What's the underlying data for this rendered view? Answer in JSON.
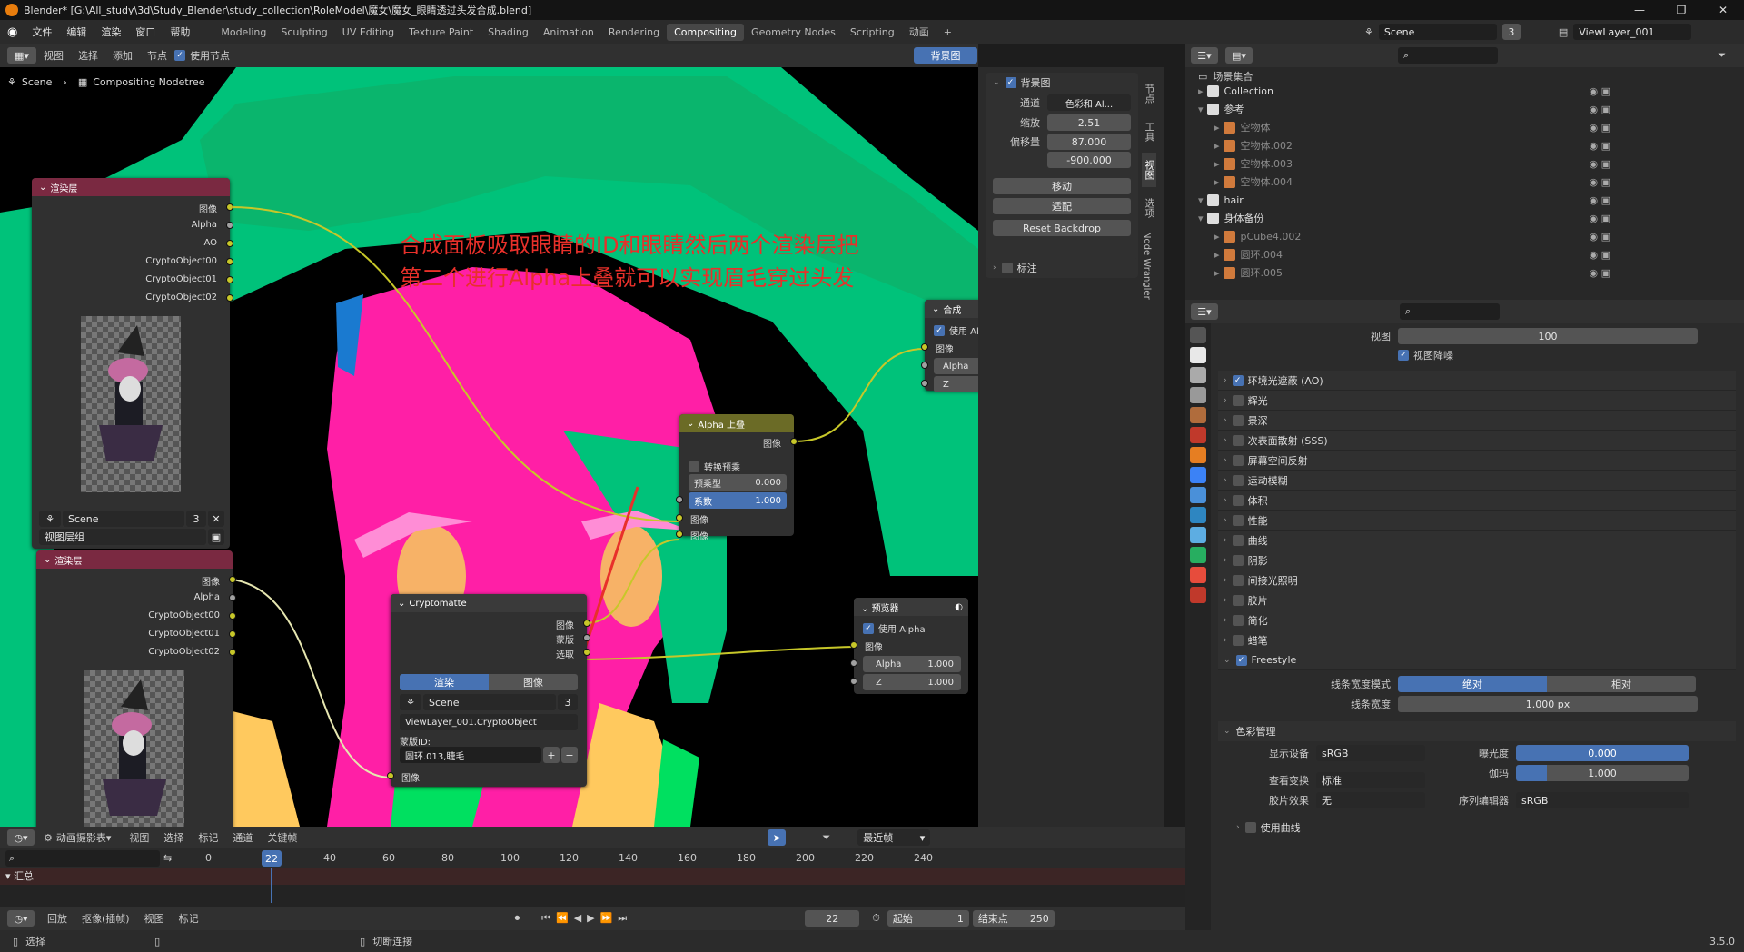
{
  "title": "Blender* [G:\\All_study\\3d\\Study_Blender\\study_collection\\RoleModel\\魔女\\魔女_眼睛透过头发合成.blend]",
  "menu": [
    "文件",
    "编辑",
    "渲染",
    "窗口",
    "帮助"
  ],
  "workspaces": [
    "Modeling",
    "Sculpting",
    "UV Editing",
    "Texture Paint",
    "Shading",
    "Animation",
    "Rendering",
    "Compositing",
    "Geometry Nodes",
    "Scripting",
    "动画"
  ],
  "active_workspace": "Compositing",
  "scene": {
    "name": "Scene",
    "count": "3"
  },
  "view_layer": "ViewLayer_001",
  "node_header": {
    "items": [
      "视图",
      "选择",
      "添加",
      "节点"
    ],
    "use_nodes": "使用节点",
    "backdrop": "背景图"
  },
  "breadcrumb": {
    "scene": "Scene",
    "tree": "Compositing Nodetree"
  },
  "annotation": {
    "line1": "合成面板吸取眼睛的ID和眼睛然后两个渲染层把",
    "line2": "第二个进行Alpha上叠就可以实现眉毛穿过头发"
  },
  "render_layer_1": {
    "title": "渲染层",
    "outputs": [
      "图像",
      "Alpha",
      "AO",
      "CryptoObject00",
      "CryptoObject01",
      "CryptoObject02"
    ],
    "scene": "Scene",
    "count": "3",
    "layer": "视图层组"
  },
  "render_layer_2": {
    "title": "渲染层",
    "outputs": [
      "图像",
      "Alpha",
      "CryptoObject00",
      "CryptoObject01",
      "CryptoObject02"
    ]
  },
  "alpha_over": {
    "title": "Alpha 上叠",
    "output": "图像",
    "convert": "转换预乘",
    "premul_label": "预乘型",
    "premul_value": "0.000",
    "fac_label": "系数",
    "fac_value": "1.000",
    "in1": "图像",
    "in2": "图像"
  },
  "composite": {
    "title": "合成",
    "use_alpha": "使用 Alpha",
    "inputs": [
      "图像",
      "Alpha",
      "Z"
    ]
  },
  "viewer": {
    "title": "预览器",
    "use_alpha": "使用 Alpha",
    "input": "图像",
    "alpha_label": "Alpha",
    "alpha_value": "1.000",
    "z_label": "Z",
    "z_value": "1.000"
  },
  "cryptomatte": {
    "title": "Cryptomatte",
    "outputs": [
      "图像",
      "蒙版",
      "选取"
    ],
    "tab1": "渲染",
    "tab2": "图像",
    "scene": "Scene",
    "count": "3",
    "layer": "ViewLayer_001.CryptoObject",
    "matte_label": "蒙版ID:",
    "matte_value": "圆环.013,睫毛",
    "input": "图像"
  },
  "backdrop_panel": {
    "title": "背景图",
    "channel_label": "通道",
    "channel_value": "色彩和 Al...",
    "zoom_label": "缩放",
    "zoom_value": "2.51",
    "offset_label": "偏移量",
    "offset_x": "87.000",
    "offset_y": "-900.000",
    "move": "移动",
    "fit": "适配",
    "reset": "Reset Backdrop",
    "annotate": "标注"
  },
  "side_tabs": [
    "节点",
    "工具",
    "视图",
    "选项",
    "Node Wrangler"
  ],
  "outliner": {
    "root": "场景集合",
    "rows": [
      {
        "label": "Collection",
        "indent": 0
      },
      {
        "label": "参考",
        "indent": 0
      },
      {
        "label": "空物体",
        "indent": 1
      },
      {
        "label": "空物体.002",
        "indent": 1
      },
      {
        "label": "空物体.003",
        "indent": 1
      },
      {
        "label": "空物体.004",
        "indent": 1
      },
      {
        "label": "hair",
        "indent": 0
      },
      {
        "label": "身体备份",
        "indent": 0
      },
      {
        "label": "pCube4.002",
        "indent": 1
      },
      {
        "label": "圆环.004",
        "indent": 1
      },
      {
        "label": "圆环.005",
        "indent": 1
      }
    ]
  },
  "properties": {
    "viewport_label": "视图",
    "viewport_value": "100",
    "denoise": "视图降噪",
    "sections": [
      "环境光遮蔽 (AO)",
      "辉光",
      "景深",
      "次表面散射 (SSS)",
      "屏幕空间反射",
      "运动模糊",
      "体积",
      "性能",
      "曲线",
      "阴影",
      "间接光照明",
      "胶片",
      "简化",
      "蜡笔",
      "Freestyle"
    ],
    "line_mode_label": "线条宽度模式",
    "line_abs": "绝对",
    "line_rel": "相对",
    "line_width_label": "线条宽度",
    "line_width_value": "1.000 px",
    "color_mgmt": "色彩管理",
    "display_label": "显示设备",
    "display_value": "sRGB",
    "view_label": "查看变换",
    "view_value": "标准",
    "look_label": "胶片效果",
    "look_value": "无",
    "exposure_label": "曝光度",
    "exposure_value": "0.000",
    "gamma_label": "伽玛",
    "gamma_value": "1.000",
    "seq_label": "序列编辑器",
    "seq_value": "sRGB",
    "curves": "使用曲线"
  },
  "timeline": {
    "mode": "动画摄影表",
    "items": [
      "视图",
      "选择",
      "标记",
      "通道",
      "关键帧"
    ],
    "snap": "最近帧",
    "ticks": [
      "0",
      "20",
      "40",
      "60",
      "80",
      "100",
      "120",
      "140",
      "160",
      "180",
      "200",
      "220",
      "240"
    ],
    "current": "22",
    "summary": "汇总",
    "playback": "回放",
    "keying": "抠像(插帧)",
    "view": "视图",
    "marker": "标记",
    "frame": "22",
    "start_label": "起始",
    "start": "1",
    "end_label": "结束点",
    "end": "250"
  },
  "status": {
    "select": "选择",
    "cut": "切断连接",
    "version": "3.5.0"
  }
}
